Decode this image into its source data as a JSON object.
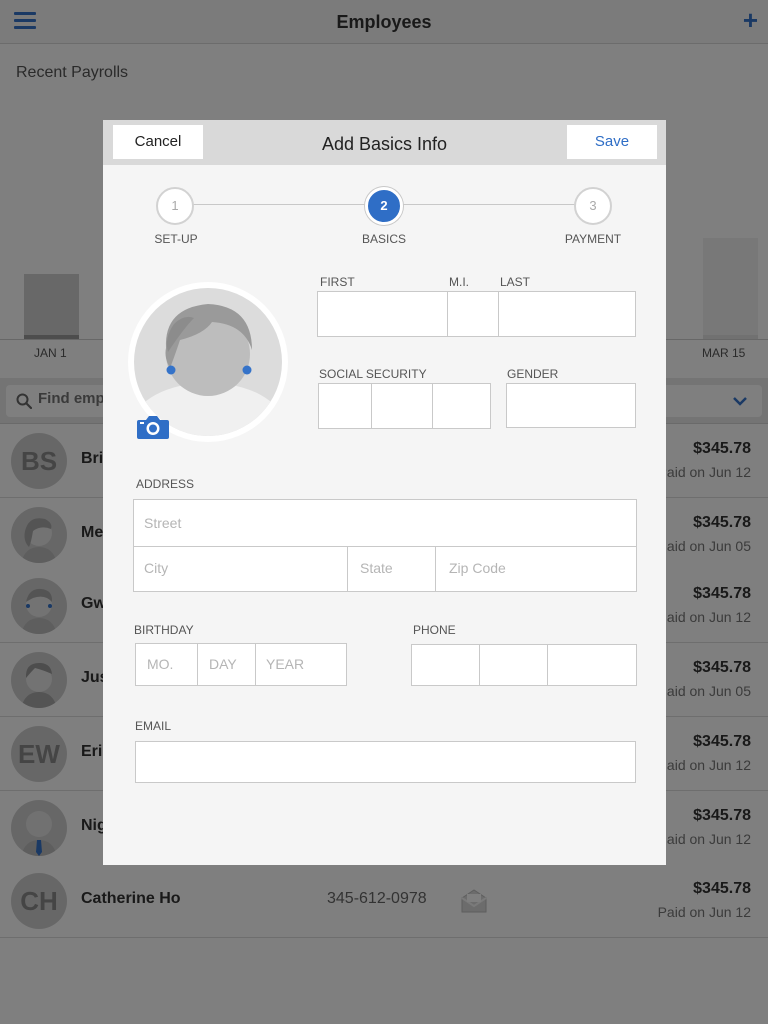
{
  "app": {
    "title": "Employees",
    "recent_payrolls_label": "Recent Payrolls",
    "chart_ticks": {
      "start": "JAN 1",
      "end": "MAR 15"
    },
    "search_placeholder": "Find emp",
    "accent_color": "#3573c9"
  },
  "employees": [
    {
      "initials": "BS",
      "name": "Bri",
      "phone": "",
      "amount": "$345.78",
      "paid": "Paid on Jun 12"
    },
    {
      "initials": "",
      "name": "Me",
      "phone": "",
      "amount": "$345.78",
      "paid": "aid on Jun 05"
    },
    {
      "initials": "",
      "name": "Gw",
      "phone": "",
      "amount": "$345.78",
      "paid": "aid on Jun 12"
    },
    {
      "initials": "",
      "name": "Jus",
      "phone": "",
      "amount": "$345.78",
      "paid": "aid on Jun 05"
    },
    {
      "initials": "EW",
      "name": "Eri",
      "phone": "",
      "amount": "$345.78",
      "paid": "aid on Jun 12"
    },
    {
      "initials": "",
      "name": "Nig",
      "phone": "",
      "amount": "$345.78",
      "paid": "aid on Jun 12"
    },
    {
      "initials": "CH",
      "name": "Catherine Ho",
      "phone": "345-612-0978",
      "amount": "$345.78",
      "paid": "Paid on Jun 12"
    }
  ],
  "modal": {
    "title": "Add Basics Info",
    "cancel_label": "Cancel",
    "save_label": "Save",
    "steps": [
      {
        "number": "1",
        "label": "SET-UP",
        "active": false
      },
      {
        "number": "2",
        "label": "BASICS",
        "active": true
      },
      {
        "number": "3",
        "label": "PAYMENT",
        "active": false
      }
    ],
    "labels": {
      "first": "FIRST",
      "mi": "M.I.",
      "last": "LAST",
      "ssn": "SOCIAL SECURITY",
      "gender": "GENDER",
      "address": "ADDRESS",
      "birthday": "BIRTHDAY",
      "phone": "PHONE",
      "email": "EMAIL"
    },
    "placeholders": {
      "street": "Street",
      "city": "City",
      "state": "State",
      "zip": "Zip Code",
      "month": "MO.",
      "day": "DAY",
      "year": "YEAR"
    },
    "primary_color": "#2f6ec6"
  }
}
